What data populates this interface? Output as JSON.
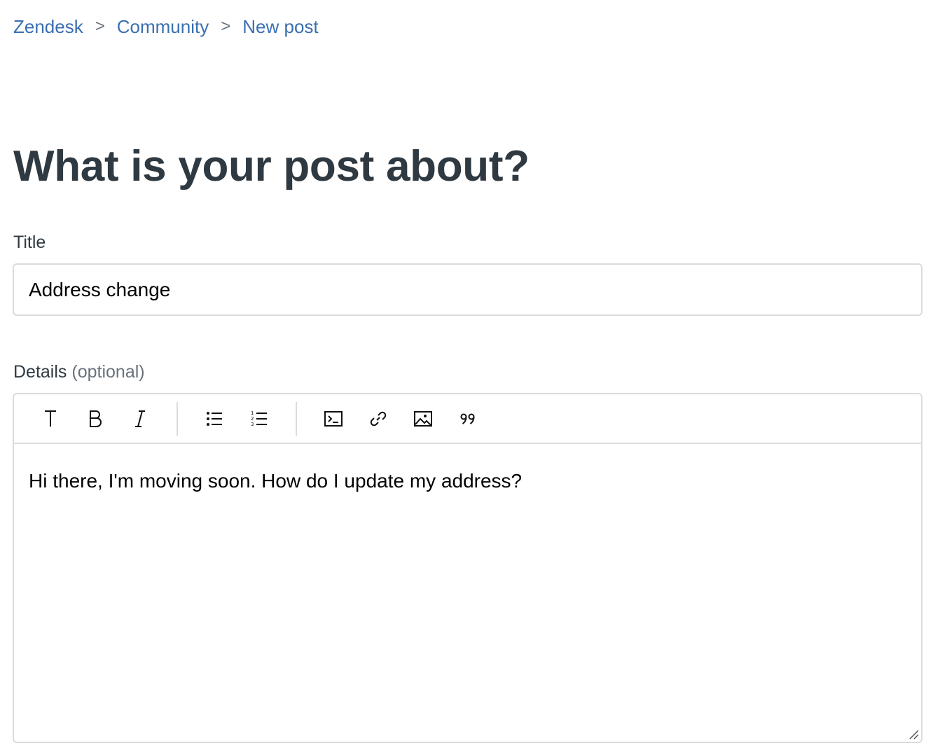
{
  "breadcrumb": {
    "items": [
      {
        "label": "Zendesk"
      },
      {
        "label": "Community"
      },
      {
        "label": "New post"
      }
    ],
    "separator": ">"
  },
  "page": {
    "title": "What is your post about?"
  },
  "form": {
    "title_label": "Title",
    "title_value": "Address change",
    "details_label": "Details",
    "details_hint": "(optional)",
    "details_value": "Hi there, I'm moving soon. How do I update my address?"
  },
  "toolbar": {
    "groups": [
      [
        "text-style-icon",
        "bold-icon",
        "italic-icon"
      ],
      [
        "bulleted-list-icon",
        "numbered-list-icon"
      ],
      [
        "code-block-icon",
        "link-icon",
        "image-icon",
        "blockquote-icon"
      ]
    ]
  },
  "colors": {
    "link": "#3a6fb0",
    "text": "#2f3941",
    "muted": "#68737d",
    "border": "#d8dcde"
  }
}
